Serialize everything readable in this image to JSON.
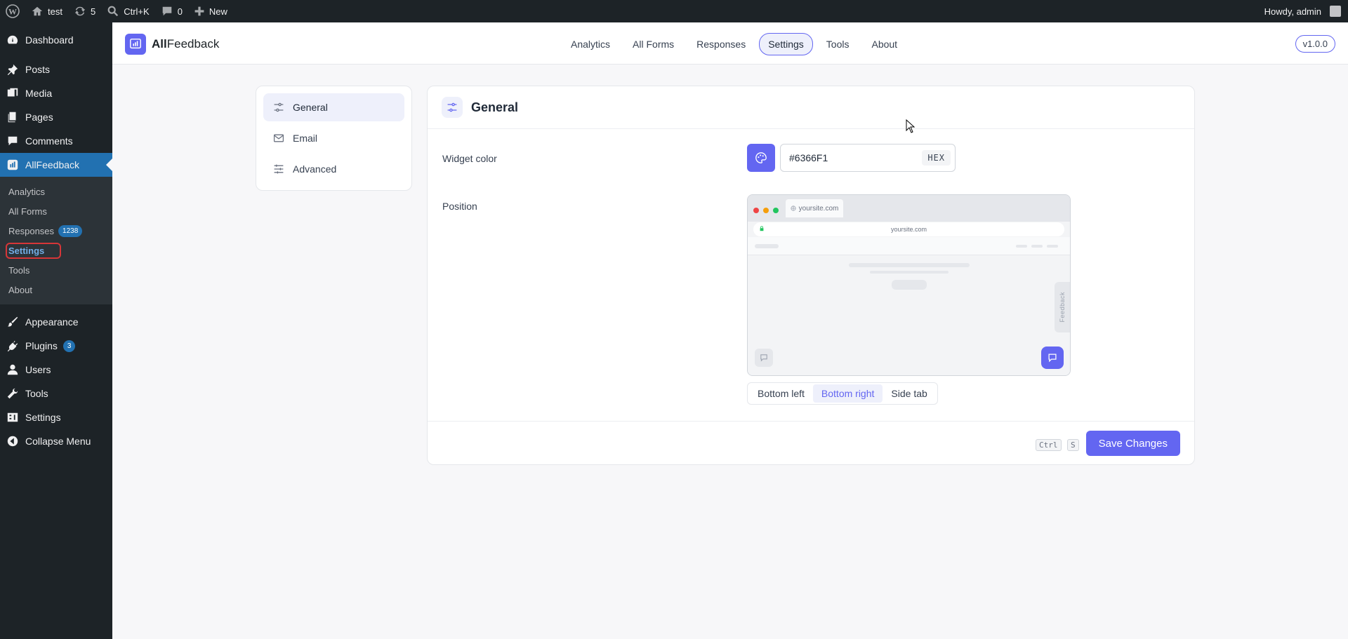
{
  "adminbar": {
    "site_name": "test",
    "updates_count": "5",
    "search_shortcut": "Ctrl+K",
    "comments_count": "0",
    "new_label": "New",
    "greeting": "Howdy, admin"
  },
  "sidebar": {
    "dashboard": "Dashboard",
    "posts": "Posts",
    "media": "Media",
    "pages": "Pages",
    "comments": "Comments",
    "allfeedback": "AllFeedback",
    "sub": {
      "analytics": "Analytics",
      "all_forms": "All Forms",
      "responses": "Responses",
      "responses_count": "1238",
      "settings": "Settings",
      "tools": "Tools",
      "about": "About"
    },
    "appearance": "Appearance",
    "plugins": "Plugins",
    "plugins_count": "3",
    "users": "Users",
    "tools": "Tools",
    "settings": "Settings",
    "collapse": "Collapse Menu"
  },
  "topbar": {
    "brand_bold": "All",
    "brand_rest": "Feedback",
    "tabs": [
      "Analytics",
      "All Forms",
      "Responses",
      "Settings",
      "Tools",
      "About"
    ],
    "active_tab": "Settings",
    "version": "v1.0.0"
  },
  "settings_nav": {
    "general": "General",
    "email": "Email",
    "advanced": "Advanced"
  },
  "card": {
    "title": "General",
    "widget_color_label": "Widget color",
    "widget_color_value": "#6366F1",
    "hex_tag": "HEX",
    "position_label": "Position",
    "preview": {
      "tab_url": "yoursite.com",
      "address": "yoursite.com",
      "side_tab": "Feedback"
    },
    "positions": [
      "Bottom left",
      "Bottom right",
      "Side tab"
    ],
    "selected_position": "Bottom right",
    "shortcut_ctrl": "Ctrl",
    "shortcut_key": "S",
    "save_label": "Save Changes"
  },
  "colors": {
    "accent": "#6366F1",
    "wp_admin_dark": "#1d2327",
    "wp_blue": "#2271b1",
    "highlight_outline": "#d63638"
  }
}
